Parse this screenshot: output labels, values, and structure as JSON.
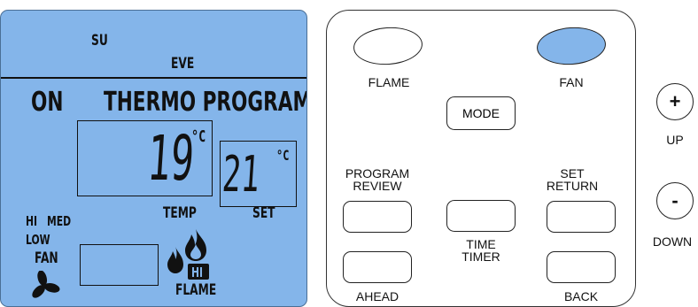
{
  "lcd": {
    "day": "SU",
    "period": "EVE",
    "status": "ON",
    "mode_title": "THERMO PROGRAM",
    "current_temp": "19",
    "current_unit": "°C",
    "set_temp": "21",
    "set_unit": "°C",
    "temp_label": "TEMP",
    "set_label": "SET",
    "fan_speed_hi": "HI",
    "fan_speed_med": "MED",
    "fan_speed_low": "LOW",
    "fan_label": "FAN",
    "flame_level": "HI",
    "flame_label": "FLAME",
    "colors": {
      "lcd_bg": "#84b5ea",
      "segment": "#111111"
    }
  },
  "panel": {
    "flame_label": "FLAME",
    "fan_label": "FAN",
    "mode_label": "MODE",
    "program_review_label_1": "PROGRAM",
    "program_review_label_2": "REVIEW",
    "set_return_label_1": "SET",
    "set_return_label_2": "RETURN",
    "time_timer_label_1": "TIME",
    "time_timer_label_2": "TIMER",
    "ahead_label": "AHEAD",
    "back_label": "BACK",
    "active_color": "#84b5ea"
  },
  "side": {
    "up_symbol": "+",
    "up_label": "UP",
    "down_symbol": "-",
    "down_label": "DOWN"
  }
}
